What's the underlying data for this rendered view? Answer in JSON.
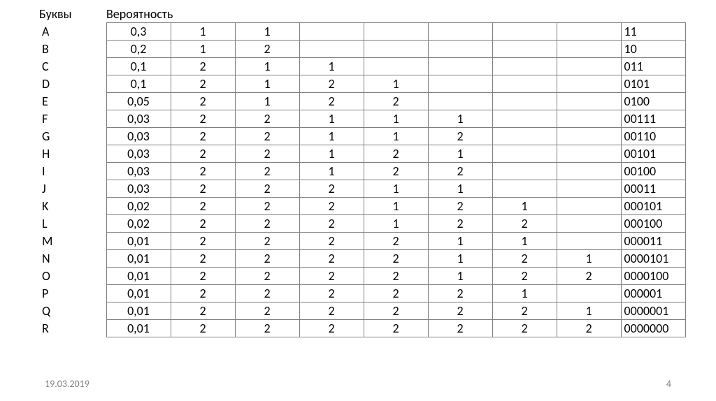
{
  "headers": {
    "letters": "Буквы",
    "probability": "Вероятность"
  },
  "rows": [
    {
      "letter": "A",
      "prob": "0,3",
      "c": [
        "1",
        "1",
        "",
        "",
        "",
        "",
        ""
      ],
      "code": "11"
    },
    {
      "letter": "B",
      "prob": "0,2",
      "c": [
        "1",
        "2",
        "",
        "",
        "",
        "",
        ""
      ],
      "code": "10"
    },
    {
      "letter": "C",
      "prob": "0,1",
      "c": [
        "2",
        "1",
        "1",
        "",
        "",
        "",
        ""
      ],
      "code": "011"
    },
    {
      "letter": "D",
      "prob": "0,1",
      "c": [
        "2",
        "1",
        "2",
        "1",
        "",
        "",
        ""
      ],
      "code": "0101"
    },
    {
      "letter": "E",
      "prob": "0,05",
      "c": [
        "2",
        "1",
        "2",
        "2",
        "",
        "",
        ""
      ],
      "code": "0100"
    },
    {
      "letter": "F",
      "prob": "0,03",
      "c": [
        "2",
        "2",
        "1",
        "1",
        "1",
        "",
        ""
      ],
      "code": "00111"
    },
    {
      "letter": "G",
      "prob": "0,03",
      "c": [
        "2",
        "2",
        "1",
        "1",
        "2",
        "",
        ""
      ],
      "code": "00110"
    },
    {
      "letter": "H",
      "prob": "0,03",
      "c": [
        "2",
        "2",
        "1",
        "2",
        "1",
        "",
        ""
      ],
      "code": "00101"
    },
    {
      "letter": "I",
      "prob": "0,03",
      "c": [
        "2",
        "2",
        "1",
        "2",
        "2",
        "",
        ""
      ],
      "code": "00100"
    },
    {
      "letter": "J",
      "prob": "0,03",
      "c": [
        "2",
        "2",
        "2",
        "1",
        "1",
        "",
        ""
      ],
      "code": "00011"
    },
    {
      "letter": "K",
      "prob": "0,02",
      "c": [
        "2",
        "2",
        "2",
        "1",
        "2",
        "1",
        ""
      ],
      "code": "000101"
    },
    {
      "letter": "L",
      "prob": "0,02",
      "c": [
        "2",
        "2",
        "2",
        "1",
        "2",
        "2",
        ""
      ],
      "code": "000100"
    },
    {
      "letter": "M",
      "prob": "0,01",
      "c": [
        "2",
        "2",
        "2",
        "2",
        "1",
        "1",
        ""
      ],
      "code": "000011"
    },
    {
      "letter": "N",
      "prob": "0,01",
      "c": [
        "2",
        "2",
        "2",
        "2",
        "1",
        "2",
        "1"
      ],
      "code": "0000101"
    },
    {
      "letter": "O",
      "prob": "0,01",
      "c": [
        "2",
        "2",
        "2",
        "2",
        "1",
        "2",
        "2"
      ],
      "code": "0000100"
    },
    {
      "letter": "P",
      "prob": "0,01",
      "c": [
        "2",
        "2",
        "2",
        "2",
        "2",
        "1",
        ""
      ],
      "code": "000001"
    },
    {
      "letter": "Q",
      "prob": "0,01",
      "c": [
        "2",
        "2",
        "2",
        "2",
        "2",
        "2",
        "1"
      ],
      "code": "0000001"
    },
    {
      "letter": "R",
      "prob": "0,01",
      "c": [
        "2",
        "2",
        "2",
        "2",
        "2",
        "2",
        "2"
      ],
      "code": "0000000"
    }
  ],
  "footer": {
    "date": "19.03.2019",
    "page": "4"
  }
}
